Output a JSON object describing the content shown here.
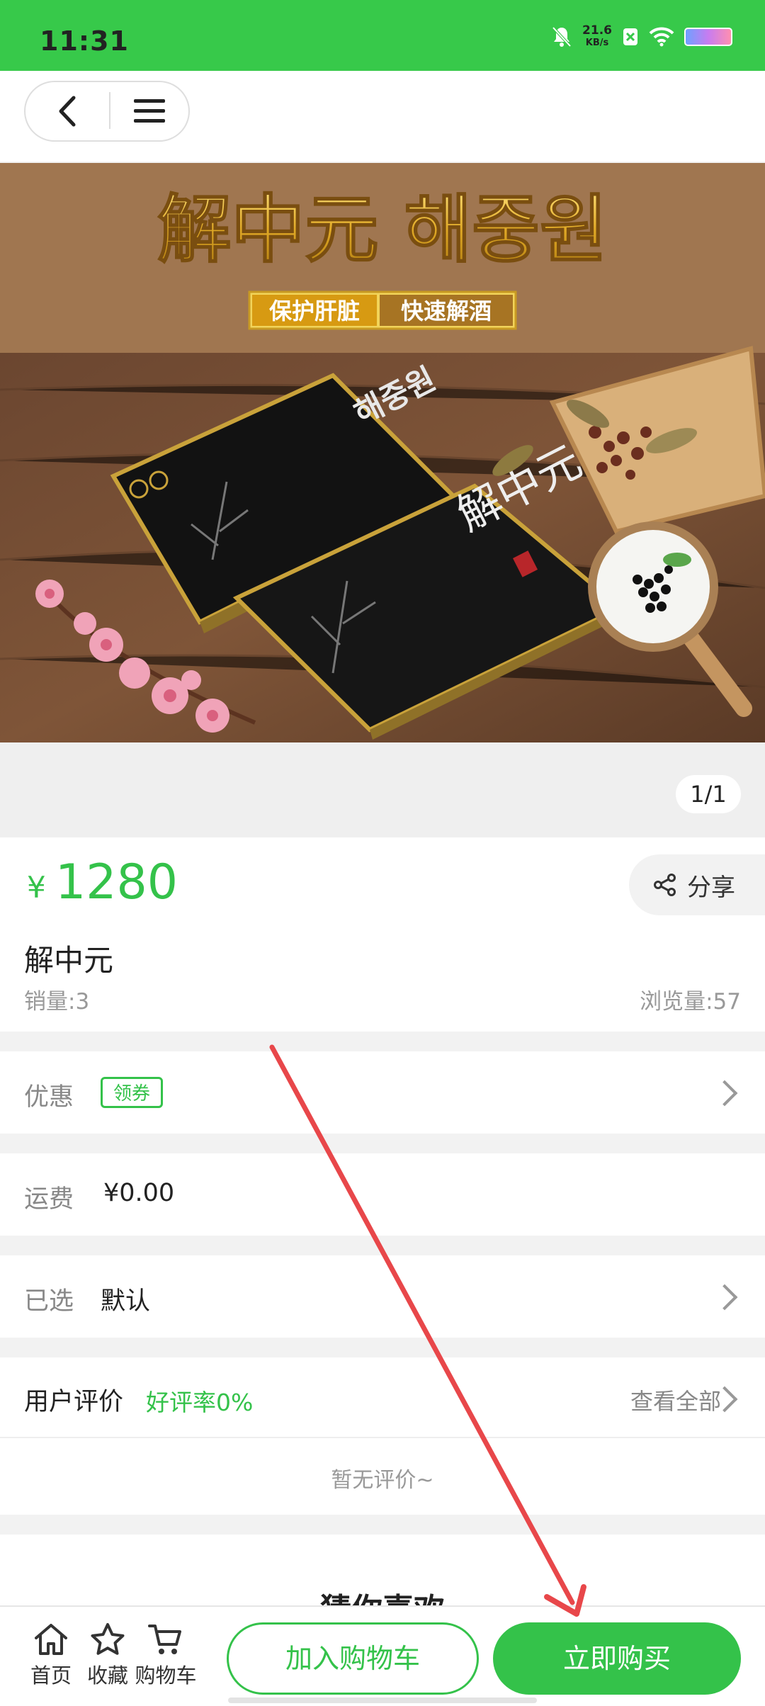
{
  "status_bar": {
    "time": "11:31",
    "net_speed": "21.6",
    "net_unit": "KB/s"
  },
  "gallery": {
    "headline": "解中元 해중원",
    "tag_left": "保护肝脏",
    "tag_right": "快速解酒",
    "box_brand_cn": "解中元",
    "box_brand_kr": "해중원",
    "counter": "1/1"
  },
  "product": {
    "currency": "¥",
    "price": "1280",
    "share_label": "分享",
    "name": "解中元",
    "sales": "销量:3",
    "views": "浏览量:57"
  },
  "rows": {
    "discount_label": "优惠",
    "coupon_label": "领券",
    "shipping_label": "运费",
    "shipping_value": "¥0.00",
    "selected_label": "已选",
    "selected_value": "默认"
  },
  "reviews": {
    "title": "用户评价",
    "rate": "好评率0%",
    "view_all": "查看全部",
    "empty": "暂无评价~"
  },
  "recommend": {
    "title": "猜你喜欢"
  },
  "bottom_bar": {
    "home": "首页",
    "favorite": "收藏",
    "cart": "购物车",
    "add_to_cart": "加入购物车",
    "buy_now": "立即购买"
  },
  "colors": {
    "accent": "#34c24a",
    "status_bar": "#37c94a",
    "annotation": "#e8474a"
  }
}
